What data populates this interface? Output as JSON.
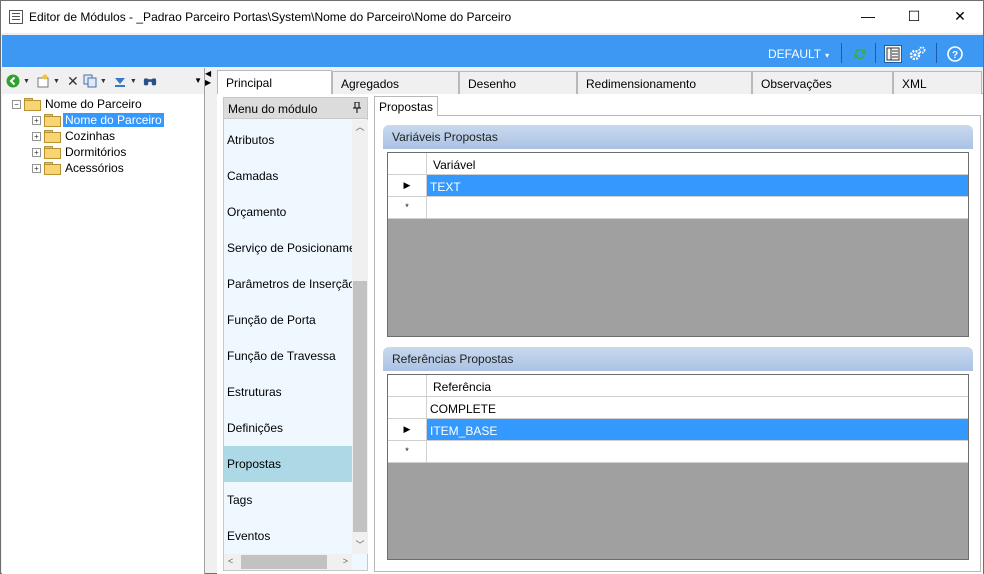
{
  "window": {
    "title": "Editor de Módulos - _Padrao Parceiro Portas\\System\\Nome do Parceiro\\Nome do Parceiro",
    "minimize": "—",
    "maximize": "☐",
    "close": "✕"
  },
  "toolbar": {
    "profile_dropdown": "DEFAULT",
    "caret": "▾",
    "icons": [
      "refresh-icon",
      "layout-icon",
      "settings-icon",
      "help-icon"
    ],
    "accent_color": "#3d98f4"
  },
  "tree_toolbar": {
    "icons": [
      "back-icon",
      "new-item-icon",
      "delete-icon",
      "copy-icon",
      "move-down-icon",
      "find-icon"
    ]
  },
  "tree": {
    "root": "Nome do Parceiro",
    "children": [
      {
        "label": "Nome do Parceiro",
        "selected": true
      },
      {
        "label": "Cozinhas",
        "selected": false
      },
      {
        "label": "Dormitórios",
        "selected": false
      },
      {
        "label": "Acessórios",
        "selected": false
      }
    ]
  },
  "tabs": [
    "Principal",
    "Agregados",
    "Desenho",
    "Redimensionamento",
    "Observações",
    "XML"
  ],
  "active_tab": "Principal",
  "module_menu": {
    "header": "Menu do módulo",
    "pin": "ꟷ",
    "items": [
      "Atributos",
      "Camadas",
      "Orçamento",
      "Serviço de Posicionamento",
      "Parâmetros de Inserção",
      "Função de Porta",
      "Função de Travessa",
      "Estruturas",
      "Definições",
      "Propostas",
      "Tags",
      "Eventos"
    ],
    "active": "Propostas"
  },
  "inner_tab": "Propostas",
  "variables_group": {
    "title": "Variáveis Propostas",
    "column": "Variável",
    "rows": [
      "TEXT"
    ],
    "selected_row": 0,
    "new_row_marker": "*",
    "current_marker": "▶"
  },
  "references_group": {
    "title": "Referências Propostas",
    "column": "Referência",
    "rows": [
      "COMPLETE",
      "ITEM_BASE"
    ],
    "selected_row": 1,
    "new_row_marker": "*",
    "current_marker": "▶"
  }
}
